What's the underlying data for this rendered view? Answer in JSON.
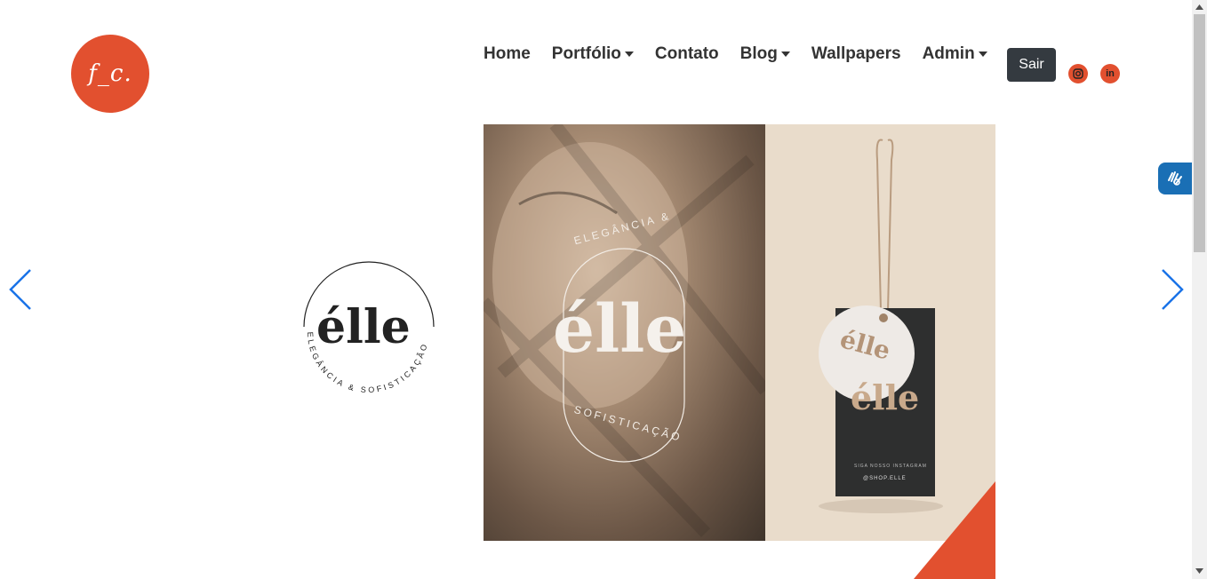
{
  "brand": {
    "logo_text": "f_c."
  },
  "nav": {
    "items": [
      {
        "label": "Home",
        "dropdown": false
      },
      {
        "label": "Portfólio",
        "dropdown": true
      },
      {
        "label": "Contato",
        "dropdown": false
      },
      {
        "label": "Blog",
        "dropdown": true
      },
      {
        "label": "Wallpapers",
        "dropdown": false
      },
      {
        "label": "Admin",
        "dropdown": true
      }
    ],
    "logout_label": "Sair"
  },
  "social": {
    "instagram_icon": "instagram-icon",
    "linkedin_label": "in"
  },
  "accessibility": {
    "icon": "sign-language-hands-icon"
  },
  "carousel": {
    "prev_icon": "chevron-left-icon",
    "next_icon": "chevron-right-icon",
    "slide": {
      "brand_name": "élle",
      "tagline_top": "ELEGÂNCIA &",
      "tagline_bottom": "SOFISTICAÇÃO",
      "badge_ring_text": "ELEGÂNCIA & SOFISTICAÇÃO",
      "tag_small_text": "SIGA NOSSO INSTAGRAM",
      "tag_handle": "@SHOP.ELLE"
    }
  },
  "colors": {
    "accent": "#e2502f",
    "nav_text": "#333333",
    "button_dark": "#343a40",
    "arrow": "#1a73e8"
  }
}
